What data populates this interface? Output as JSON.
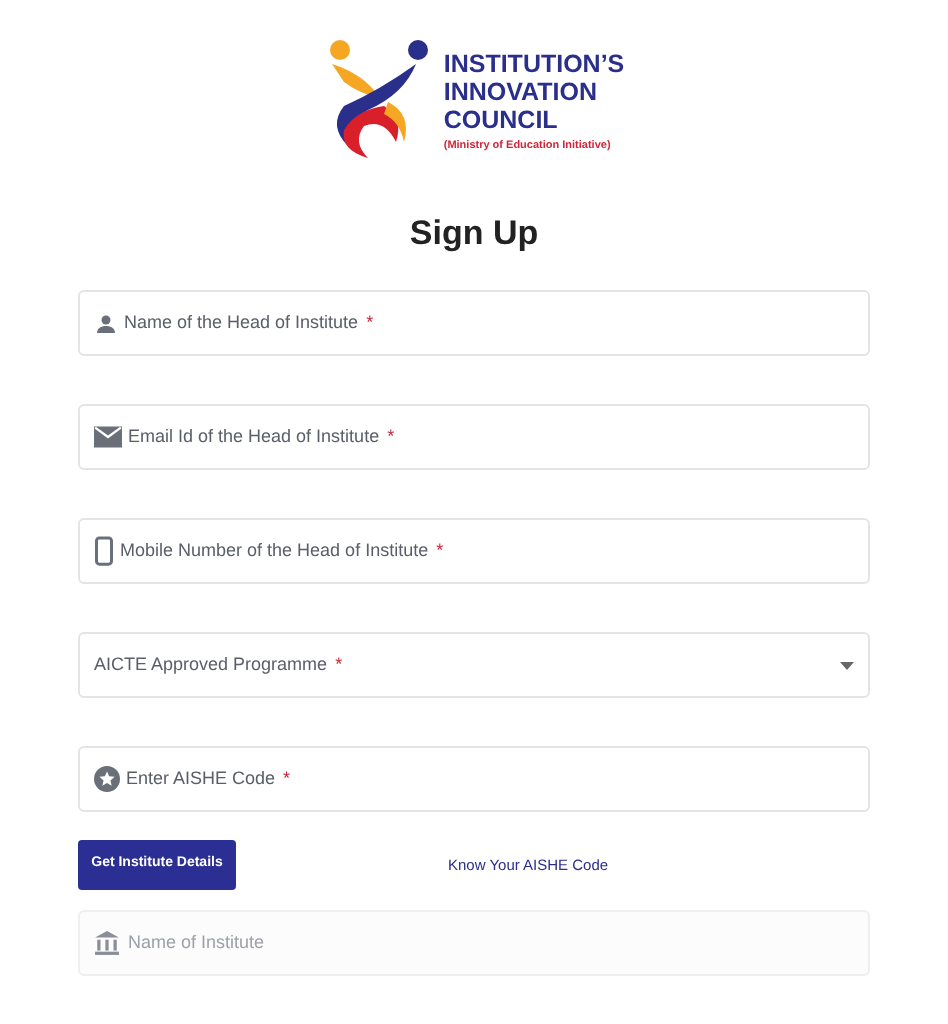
{
  "logo": {
    "lines": [
      "INSTITUTION’S",
      "INNOVATION",
      "COUNCIL"
    ],
    "subtitle": "(Ministry of Education Initiative)"
  },
  "title": "Sign Up",
  "fields": [
    {
      "kind": "text",
      "placeholder": "Name of the Head of Institute",
      "required_mark": "*",
      "disabled": false
    },
    {
      "kind": "text",
      "placeholder": "Email Id of the Head of Institute",
      "required_mark": "*",
      "disabled": false
    },
    {
      "kind": "text",
      "placeholder": "Mobile Number of the Head of Institute",
      "required_mark": "*",
      "disabled": false
    },
    {
      "kind": "select",
      "placeholder": "AICTE Approved Programme",
      "required_mark": "*",
      "disabled": false
    },
    {
      "kind": "text",
      "placeholder": "Enter AISHE Code",
      "required_mark": "*",
      "disabled": false
    }
  ],
  "actions": {
    "button": "Get Institute Details",
    "link": "Know Your AISHE Code"
  },
  "institute_field": {
    "placeholder": "Name of Institute",
    "disabled": true
  }
}
